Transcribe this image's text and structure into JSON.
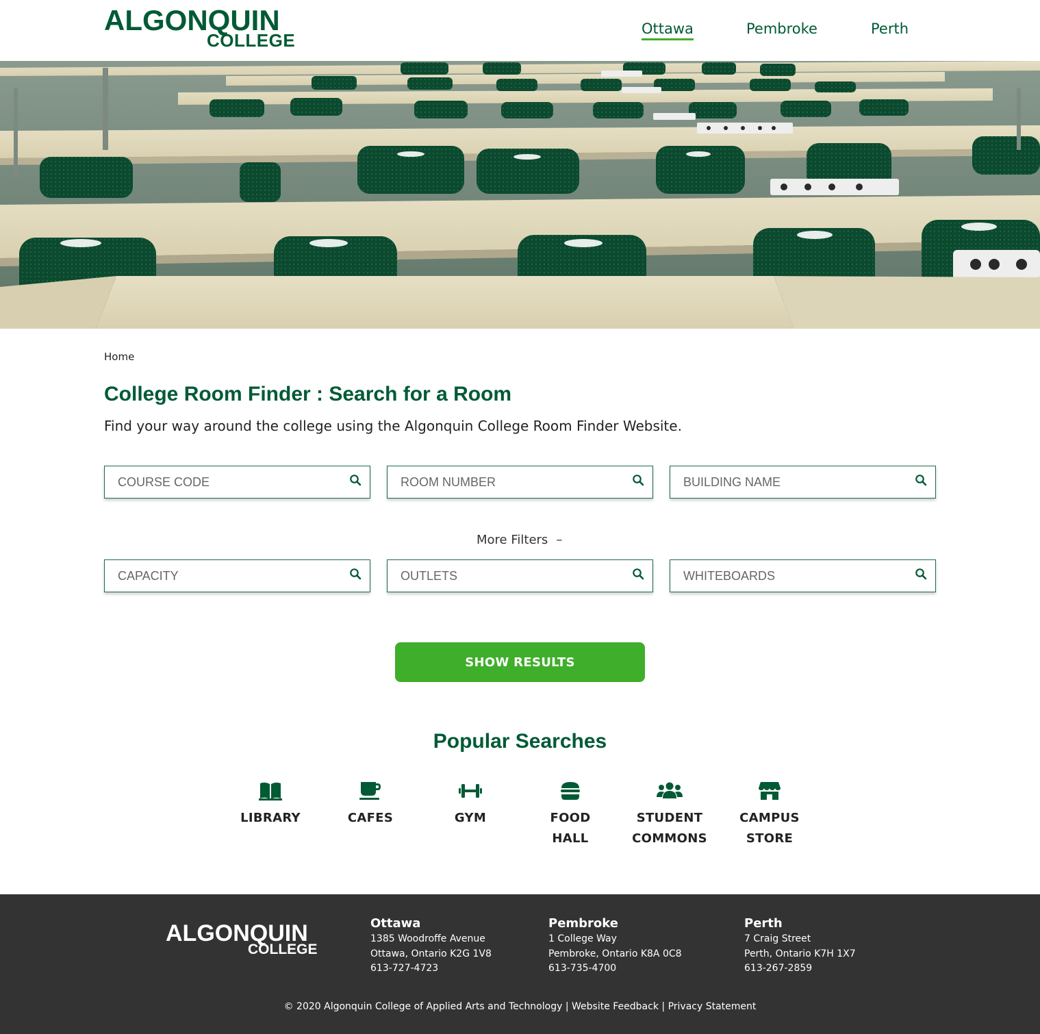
{
  "header": {
    "logo_line1": "ALGONQUIN",
    "logo_line2": "COLLEGE",
    "nav": [
      "Ottawa",
      "Pembroke",
      "Perth"
    ],
    "active_nav": "Ottawa"
  },
  "breadcrumb": "Home",
  "title": "College Room Finder : Search for a Room",
  "subtitle": "Find your way around the college using the Algonquin College Room Finder Website.",
  "search": {
    "course_code_placeholder": "COURSE CODE",
    "room_number_placeholder": "ROOM NUMBER",
    "building_name_placeholder": "BUILDING NAME",
    "more_filters": "More Filters",
    "more_filters_toggle": "–",
    "capacity_placeholder": "CAPACITY",
    "outlets_placeholder": "OUTLETS",
    "whiteboards_placeholder": "WHITEBOARDS",
    "show_results": "SHOW RESULTS",
    "icon": "search-icon"
  },
  "popular": {
    "title": "Popular Searches",
    "items": [
      {
        "line1": "LIBRARY",
        "line2": "",
        "icon": "book-icon"
      },
      {
        "line1": "CAFES",
        "line2": "",
        "icon": "coffee-icon"
      },
      {
        "line1": "GYM",
        "line2": "",
        "icon": "dumbbell-icon"
      },
      {
        "line1": "FOOD",
        "line2": "HALL",
        "icon": "hamburger-icon"
      },
      {
        "line1": "STUDENT",
        "line2": "COMMONS",
        "icon": "users-icon"
      },
      {
        "line1": "CAMPUS",
        "line2": "STORE",
        "icon": "store-icon"
      }
    ]
  },
  "footer": {
    "logo_line1": "ALGONQUIN",
    "logo_line2": "COLLEGE",
    "campuses": [
      {
        "name": "Ottawa",
        "address1": "1385 Woodroffe Avenue",
        "address2": "Ottawa, Ontario K2G 1V8",
        "phone": "613-727-4723"
      },
      {
        "name": "Pembroke",
        "address1": "1 College Way",
        "address2": "Pembroke, Ontario K8A 0C8",
        "phone": "613-735-4700"
      },
      {
        "name": "Perth",
        "address1": "7 Craig Street",
        "address2": "Perth, Ontario K7H 1X7",
        "phone": "613-267-2859"
      }
    ],
    "copyright_symbol": "©",
    "copyright": "2020 Algonquin College of Applied Arts and Technology",
    "separator": "|",
    "feedback": "Website Feedback",
    "privacy": "Privacy Statement"
  },
  "colors": {
    "brand_green": "#005a35",
    "accent_green": "#3fae2a",
    "footer_bg": "#333333"
  }
}
